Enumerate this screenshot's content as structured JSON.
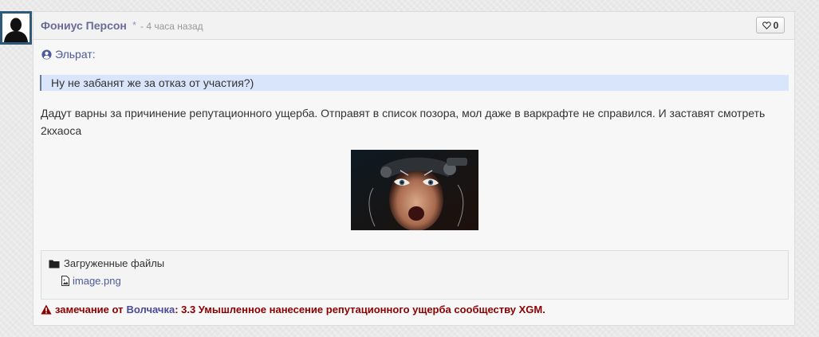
{
  "post": {
    "author": "Фониус Персон",
    "author_mark": "*",
    "timeago": "- 4 часа назад",
    "likes": "0",
    "avatar_icon": "user-silhouette-icon"
  },
  "quote": {
    "author": "Эльрат:",
    "text": "Ну не забанят же за отказ от участия?)",
    "icon": "user-circle-icon"
  },
  "body": {
    "text": "Дадут варны за причинение репутационного ущерба. Отправят в список позора, мол даже в варкрафте не справился. И заставят смотреть 2кхаоса"
  },
  "attachments": {
    "title": "Загруженные файлы",
    "title_icon": "folder-icon",
    "files": [
      {
        "name": "image.png",
        "icon": "file-image-icon"
      }
    ]
  },
  "warning": {
    "icon": "warning-triangle-icon",
    "prefix": "замечание от",
    "moderator": "Волчачка",
    "text": ": 3.3 Умышленное нанесение репутационного ущерба сообществу XGM."
  },
  "colors": {
    "author": "#6a6a99",
    "link": "#4a5a9a",
    "quote_bg": "#d9e5fb",
    "warning": "#8b0000"
  }
}
